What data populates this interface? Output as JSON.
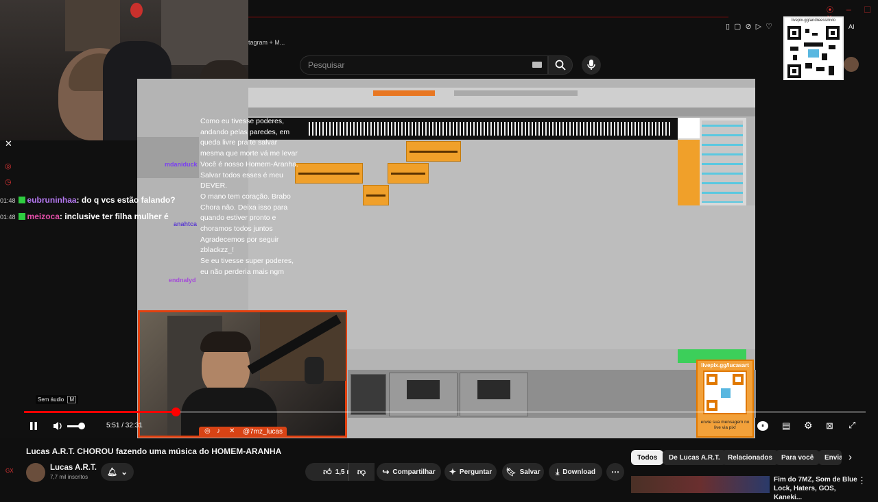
{
  "browser": {
    "tab_partial": "tagram + M...",
    "toolbar_right_text": "AI"
  },
  "search": {
    "placeholder": "Pesquisar"
  },
  "stream_overlay": {
    "qr_top_label": "livepix.gg/andreessmvio",
    "qr_bottom_label": "livepix.gg/lucasart",
    "qr_bottom_caption": "envie sua mensagem no live via pix!",
    "social_handle": "@7mz_lucas",
    "chat_overlay": [
      {
        "time": "01:48",
        "user": "eubruninhaa",
        "message": "do q vcs estão falando?"
      },
      {
        "time": "01:48",
        "user": "meizoca",
        "message": "inclusive ter filha mulher é"
      }
    ],
    "chat_panel": [
      {
        "user": "",
        "message": "Como eu tivesse poderes,"
      },
      {
        "user": "",
        "message": "andando pelas paredes, em"
      },
      {
        "user": "",
        "message": "queda livre pra te salvar"
      },
      {
        "user": "",
        "message": "mesma que morte vá me levar"
      },
      {
        "user": "mdaniduck",
        "message": "Você é nosso Homem-Aranha."
      },
      {
        "user": "",
        "message": "Salvar todos esses é meu"
      },
      {
        "user": "",
        "message": "DEVER."
      },
      {
        "user": "",
        "message": "O mano tem coração. Brabo"
      },
      {
        "user": "anahtca",
        "message": "Chora não. Deixa isso para"
      },
      {
        "user": "",
        "message": "quando estiver pronto e"
      },
      {
        "user": "",
        "message": "choramos todos juntos"
      },
      {
        "user": "",
        "message": "Agradecemos por seguir"
      },
      {
        "user": "",
        "message": "zblackzz_!"
      },
      {
        "user": "endnalyd",
        "message": "Se eu tivesse super poderes,"
      },
      {
        "user": "",
        "message": "eu não perderia mais ngm"
      }
    ]
  },
  "player": {
    "mute_tooltip": "Sem áudio",
    "mute_shortcut": "M",
    "current_time": "5:51",
    "duration": "32:31",
    "time_display": "5:51 / 32:31",
    "progress_fraction": 0.18
  },
  "video": {
    "title": "Lucas A.R.T. CHOROU fazendo uma música do HOMEM-ARANHA",
    "channel_name": "Lucas A.R.T.",
    "subscribers": "7,7 mil inscritos",
    "like_count": "1,5 mil",
    "share_label": "Compartilhar",
    "ask_label": "Perguntar",
    "save_label": "Salvar",
    "download_label": "Download"
  },
  "chips": [
    "Todos",
    "De Lucas A.R.T.",
    "Relacionados",
    "Para você",
    "Envia"
  ],
  "related": {
    "title": "Fim do 7MZ, Som de Blue Lock, Haters, GOS, Kaneki..."
  },
  "colors": {
    "accent_red": "#ff0000",
    "daw_clip": "#f0a02a",
    "overlay_border": "#e2400f"
  }
}
